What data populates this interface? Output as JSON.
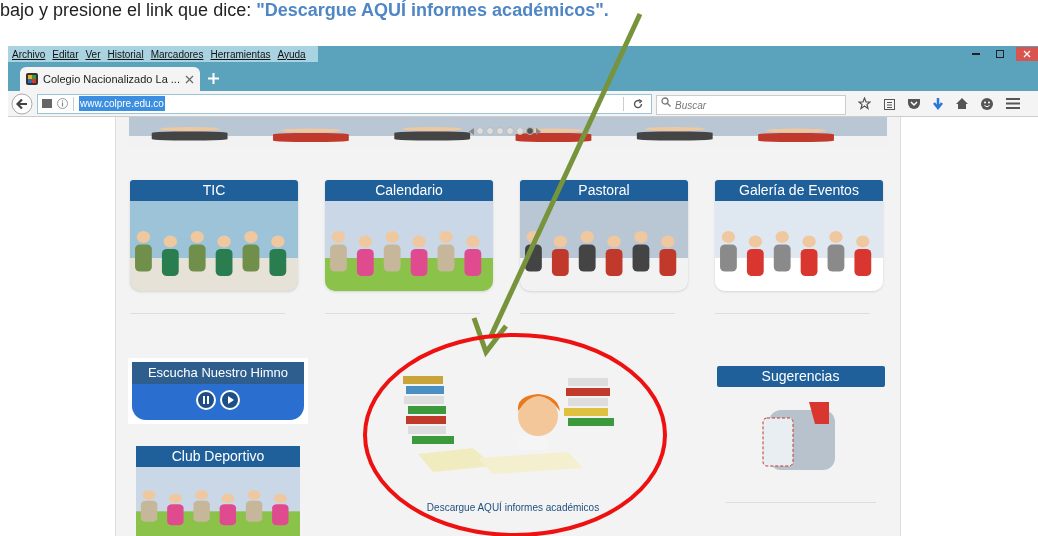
{
  "caption": {
    "text": "bajo y presione el link que dice:",
    "link": "\"Descargue AQUÍ informes académicos\"."
  },
  "menu": [
    "Archivo",
    "Editar",
    "Ver",
    "Historial",
    "Marcadores",
    "Herramientas",
    "Ayuda"
  ],
  "tab": {
    "title": "Colegio Nacionalizado La ..."
  },
  "address": {
    "value": "www.colpre.edu.co"
  },
  "search": {
    "placeholder": "Buscar"
  },
  "slider_dots": [
    {
      "selected": false
    },
    {
      "selected": false
    },
    {
      "selected": false
    },
    {
      "selected": false
    },
    {
      "selected": false
    },
    {
      "selected": true
    }
  ],
  "tiles": [
    {
      "title": "TIC"
    },
    {
      "title": "Calendario"
    },
    {
      "title": "Pastoral"
    },
    {
      "title": "Galería de Eventos"
    }
  ],
  "left_widgets": [
    {
      "title": "Escucha Nuestro Himno",
      "kind": "player"
    },
    {
      "title": "Club Deportivo"
    }
  ],
  "center": {
    "link": "Descargue AQUÍ informes académicos"
  },
  "right_widget": {
    "title": "Sugerencias"
  }
}
